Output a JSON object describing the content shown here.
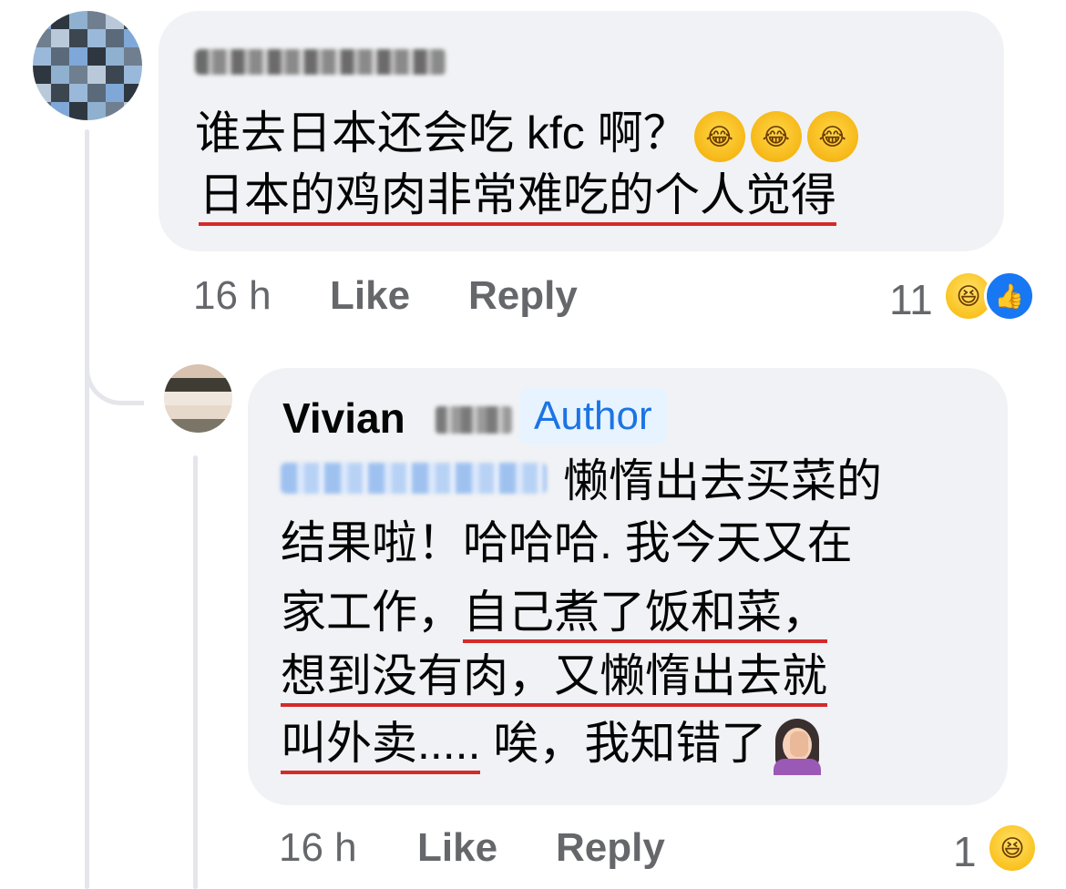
{
  "thread": {
    "comment": {
      "author_name": "",
      "lines": [
        "谁去日本还会吃 kfc 啊？",
        "日本的鸡肉非常难吃的个人觉得"
      ],
      "emoji": [
        "rolling-on-floor-laughing",
        "rolling-on-floor-laughing",
        "rolling-on-floor-laughing"
      ],
      "time": "16 h",
      "like_label": "Like",
      "reply_label": "Reply",
      "reaction_count": "11",
      "reactions": [
        "haha",
        "like"
      ]
    },
    "reply": {
      "author_name": "Vivian",
      "author_badge": "Author",
      "line1_suffix": "懒惰出去买菜的",
      "line2": "结果啦！哈哈哈. 我今天又在",
      "line3_plain": "家工作，",
      "line3_underlined": "自己煮了饭和菜，",
      "line4": "想到没有肉，又懒惰出去就",
      "line5_underlined": "叫外卖.....",
      "line5_rest": " 唉，我知错了",
      "emoji": "woman-facepalming",
      "time": "16 h",
      "like_label": "Like",
      "reply_label": "Reply",
      "reaction_count": "1",
      "reactions": [
        "haha"
      ]
    }
  },
  "colors": {
    "bubble": "#f0f2f5",
    "author_badge_text": "#1b74e4",
    "author_badge_bg": "#e7f3ff",
    "meta_text": "#65676b",
    "underline": "#d42a2a"
  }
}
